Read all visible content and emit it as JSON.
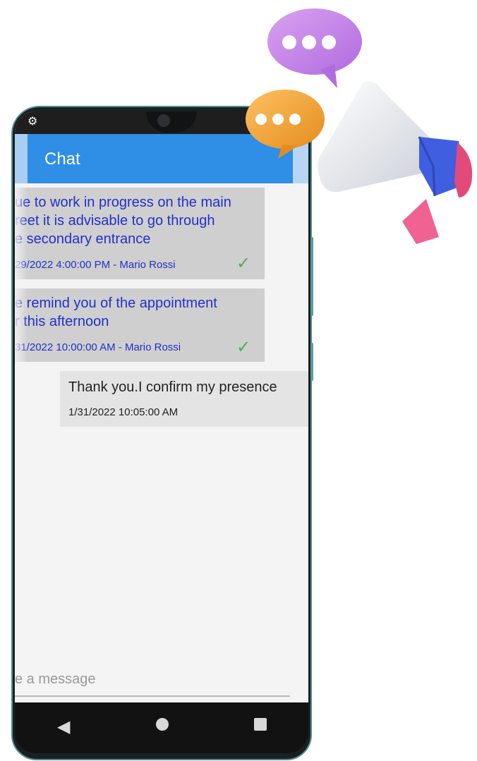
{
  "app": {
    "title": "Chat"
  },
  "status_icons": {
    "settings": "gear-icon"
  },
  "messages": [
    {
      "text": "ue to work in progress on the main\nreet it is advisable to go through\ne secondary entrance",
      "meta": "29/2022 4:00:00 PM - Mario Rossi",
      "status": "check-icon"
    },
    {
      "text": "e remind you of the appointment\nr this afternoon",
      "meta": "31/2022 10:00:00 AM - Mario Rossi",
      "status": "check-icon"
    }
  ],
  "own_message": {
    "text": "Thank you.I confirm my presence",
    "meta": "1/31/2022 10:05:00 AM"
  },
  "composer": {
    "placeholder": "e a message"
  },
  "nav": {
    "back": "◀",
    "home": "●",
    "recent": "■"
  },
  "colors": {
    "appbar": "#2f8ee5",
    "incoming_bubble": "#cfcfcf",
    "incoming_text": "#2230c8",
    "check": "#4caf50",
    "bubble_purple": "#c27ee8",
    "bubble_orange": "#f4a83a",
    "megaphone_blue": "#3f5fe0",
    "megaphone_pink": "#f06292"
  }
}
